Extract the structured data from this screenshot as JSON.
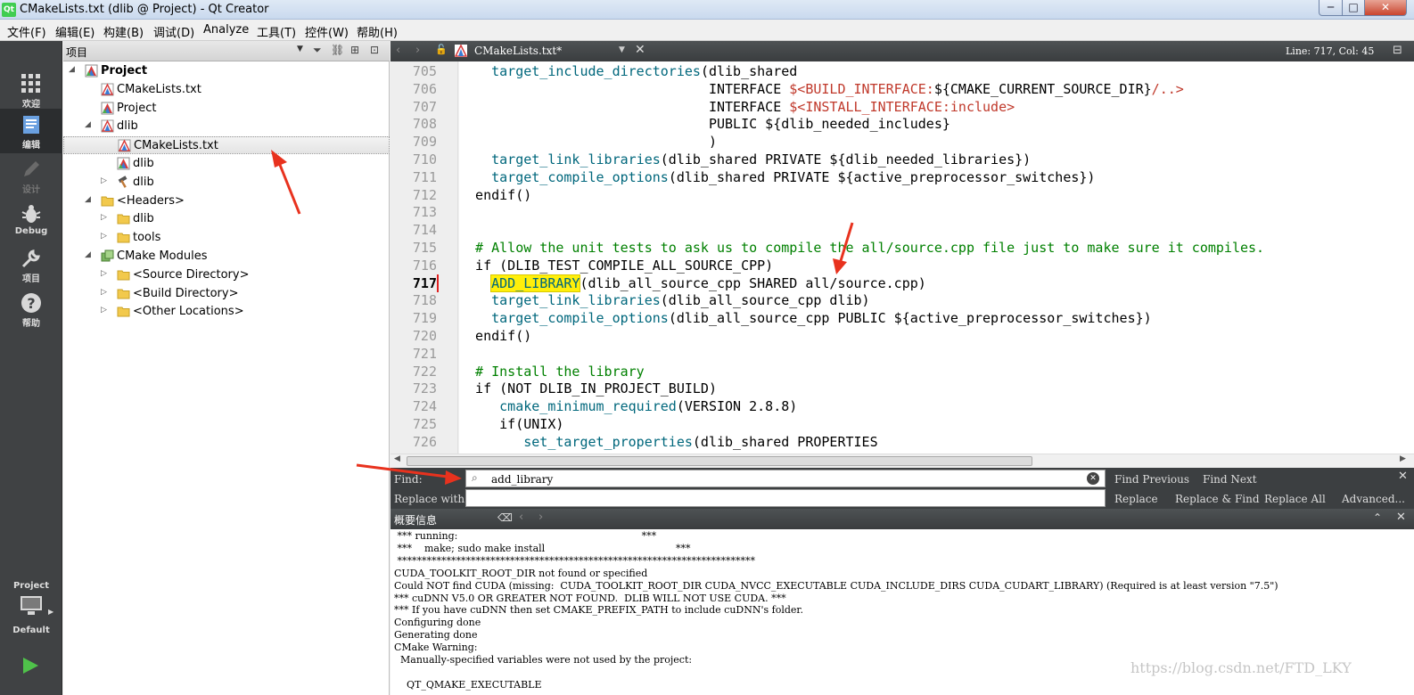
{
  "window": {
    "app_icon": "qt",
    "title": "CMakeLists.txt (dlib @ Project) - Qt Creator",
    "min": "─",
    "max": "□",
    "close": "✕"
  },
  "menu": [
    "文件(F)",
    "编辑(E)",
    "构建(B)",
    "调试(D)",
    "Analyze",
    "工具(T)",
    "控件(W)",
    "帮助(H)"
  ],
  "modes": [
    {
      "label": "欢迎",
      "icon": "grid-icon"
    },
    {
      "label": "编辑",
      "icon": "edit-icon"
    },
    {
      "label": "设计",
      "icon": "pen-icon"
    },
    {
      "label": "Debug",
      "icon": "bug-icon"
    },
    {
      "label": "项目",
      "icon": "wrench-icon"
    },
    {
      "label": "帮助",
      "icon": "help-icon"
    }
  ],
  "kit": {
    "project": "Project",
    "config": "Default"
  },
  "project_panel": {
    "title": "项目",
    "tree": [
      {
        "label": "Project",
        "depth": 0,
        "arrow": "◢",
        "icon": "cmake-project-icon",
        "bold": true
      },
      {
        "label": "CMakeLists.txt",
        "depth": 1,
        "arrow": "",
        "icon": "cmake-file-icon"
      },
      {
        "label": "Project",
        "depth": 1,
        "arrow": "",
        "icon": "cmake-project-icon"
      },
      {
        "label": "dlib",
        "depth": 1,
        "arrow": "◢",
        "icon": "cmake-file-icon"
      },
      {
        "label": "CMakeLists.txt",
        "depth": 2,
        "arrow": "",
        "icon": "cmake-file-icon",
        "selected": true
      },
      {
        "label": "dlib",
        "depth": 2,
        "arrow": "",
        "icon": "cmake-project-icon"
      },
      {
        "label": "dlib",
        "depth": 2,
        "arrow": "▷",
        "icon": "hammer-icon"
      },
      {
        "label": "<Headers>",
        "depth": 1,
        "arrow": "◢",
        "icon": "folder-icon"
      },
      {
        "label": "dlib",
        "depth": 2,
        "arrow": "▷",
        "icon": "folder-icon"
      },
      {
        "label": "tools",
        "depth": 2,
        "arrow": "▷",
        "icon": "folder-icon"
      },
      {
        "label": "CMake Modules",
        "depth": 1,
        "arrow": "◢",
        "icon": "modules-icon"
      },
      {
        "label": "<Source Directory>",
        "depth": 2,
        "arrow": "▷",
        "icon": "folder-icon"
      },
      {
        "label": "<Build Directory>",
        "depth": 2,
        "arrow": "▷",
        "icon": "folder-icon"
      },
      {
        "label": "<Other Locations>",
        "depth": 2,
        "arrow": "▷",
        "icon": "folder-icon"
      }
    ]
  },
  "editor": {
    "tab": "CMakeLists.txt*",
    "position": "Line: 717, Col: 45",
    "current_line": 717,
    "lines": [
      {
        "n": 705,
        "parts": [
          [
            "    ",
            ""
          ],
          [
            "target_include_directories",
            "fn"
          ],
          [
            "(dlib_shared",
            ""
          ]
        ]
      },
      {
        "n": 706,
        "parts": [
          [
            "                               INTERFACE ",
            ""
          ],
          [
            "$<BUILD_INTERFACE:",
            "gv"
          ],
          [
            "${CMAKE_CURRENT_SOURCE_DIR}",
            ""
          ],
          [
            "/..>",
            "gv"
          ]
        ]
      },
      {
        "n": 707,
        "parts": [
          [
            "                               INTERFACE ",
            ""
          ],
          [
            "$<INSTALL_INTERFACE:include>",
            "gv"
          ]
        ]
      },
      {
        "n": 708,
        "parts": [
          [
            "                               PUBLIC ${dlib_needed_includes}",
            ""
          ]
        ]
      },
      {
        "n": 709,
        "parts": [
          [
            "                               )",
            ""
          ]
        ]
      },
      {
        "n": 710,
        "parts": [
          [
            "    ",
            ""
          ],
          [
            "target_link_libraries",
            "fn"
          ],
          [
            "(dlib_shared PRIVATE ${dlib_needed_libraries})",
            ""
          ]
        ]
      },
      {
        "n": 711,
        "parts": [
          [
            "    ",
            ""
          ],
          [
            "target_compile_options",
            "fn"
          ],
          [
            "(dlib_shared PRIVATE ${active_preprocessor_switches})",
            ""
          ]
        ]
      },
      {
        "n": 712,
        "parts": [
          [
            "  endif()",
            ""
          ]
        ]
      },
      {
        "n": 713,
        "parts": []
      },
      {
        "n": 714,
        "parts": []
      },
      {
        "n": 715,
        "parts": [
          [
            "  # Allow the unit tests to ask us to compile the all/source.cpp file just to make sure it compiles.",
            "cm"
          ]
        ]
      },
      {
        "n": 716,
        "parts": [
          [
            "  if (DLIB_TEST_COMPILE_ALL_SOURCE_CPP)",
            ""
          ]
        ]
      },
      {
        "n": 717,
        "parts": [
          [
            "    ",
            ""
          ],
          [
            "ADD_LIBRARY",
            "hl"
          ],
          [
            "(dlib_all_source_cpp SHARED all/source.cpp)",
            ""
          ]
        ]
      },
      {
        "n": 718,
        "parts": [
          [
            "    ",
            ""
          ],
          [
            "target_link_libraries",
            "fn"
          ],
          [
            "(dlib_all_source_cpp dlib)",
            ""
          ]
        ]
      },
      {
        "n": 719,
        "parts": [
          [
            "    ",
            ""
          ],
          [
            "target_compile_options",
            "fn"
          ],
          [
            "(dlib_all_source_cpp PUBLIC ${active_preprocessor_switches})",
            ""
          ]
        ]
      },
      {
        "n": 720,
        "parts": [
          [
            "  endif()",
            ""
          ]
        ]
      },
      {
        "n": 721,
        "parts": []
      },
      {
        "n": 722,
        "parts": [
          [
            "  # Install the library",
            "cm"
          ]
        ]
      },
      {
        "n": 723,
        "parts": [
          [
            "  if (NOT DLIB_IN_PROJECT_BUILD)",
            ""
          ]
        ]
      },
      {
        "n": 724,
        "parts": [
          [
            "     ",
            ""
          ],
          [
            "cmake_minimum_required",
            "fn"
          ],
          [
            "(VERSION 2.8.8)",
            ""
          ]
        ]
      },
      {
        "n": 725,
        "parts": [
          [
            "     if(UNIX)",
            ""
          ]
        ]
      },
      {
        "n": 726,
        "parts": [
          [
            "        ",
            ""
          ],
          [
            "set_target_properties",
            "fn"
          ],
          [
            "(dlib_shared PROPERTIES",
            ""
          ]
        ]
      }
    ]
  },
  "find": {
    "find_label": "Find:",
    "find_value": "add_library",
    "replace_label": "Replace with:",
    "replace_value": "",
    "find_previous": "Find Previous",
    "find_next": "Find Next",
    "replace": "Replace",
    "replace_find": "Replace & Find",
    "replace_all": "Replace All",
    "advanced": "Advanced..."
  },
  "output": {
    "title": "概要信息",
    "lines": [
      " *** running:                                                           ***",
      " ***    make; sudo make install                                          ***",
      " *************************************************************************",
      "CUDA_TOOLKIT_ROOT_DIR not found or specified",
      "Could NOT find CUDA (missing:  CUDA_TOOLKIT_ROOT_DIR CUDA_NVCC_EXECUTABLE CUDA_INCLUDE_DIRS CUDA_CUDART_LIBRARY) (Required is at least version \"7.5\")",
      "*** cuDNN V5.0 OR GREATER NOT FOUND.  DLIB WILL NOT USE CUDA. ***",
      "*** If you have cuDNN then set CMAKE_PREFIX_PATH to include cuDNN's folder.",
      "Configuring done",
      "Generating done",
      "CMake Warning:",
      "  Manually-specified variables were not used by the project:",
      "",
      "    QT_QMAKE_EXECUTABLE"
    ]
  },
  "watermark": "https://blog.csdn.net/FTD_LKY",
  "colors": {
    "annotation_arrow": "#e8321e",
    "highlight": "#ffef0b",
    "function": "#00677c",
    "comment": "#008000"
  }
}
